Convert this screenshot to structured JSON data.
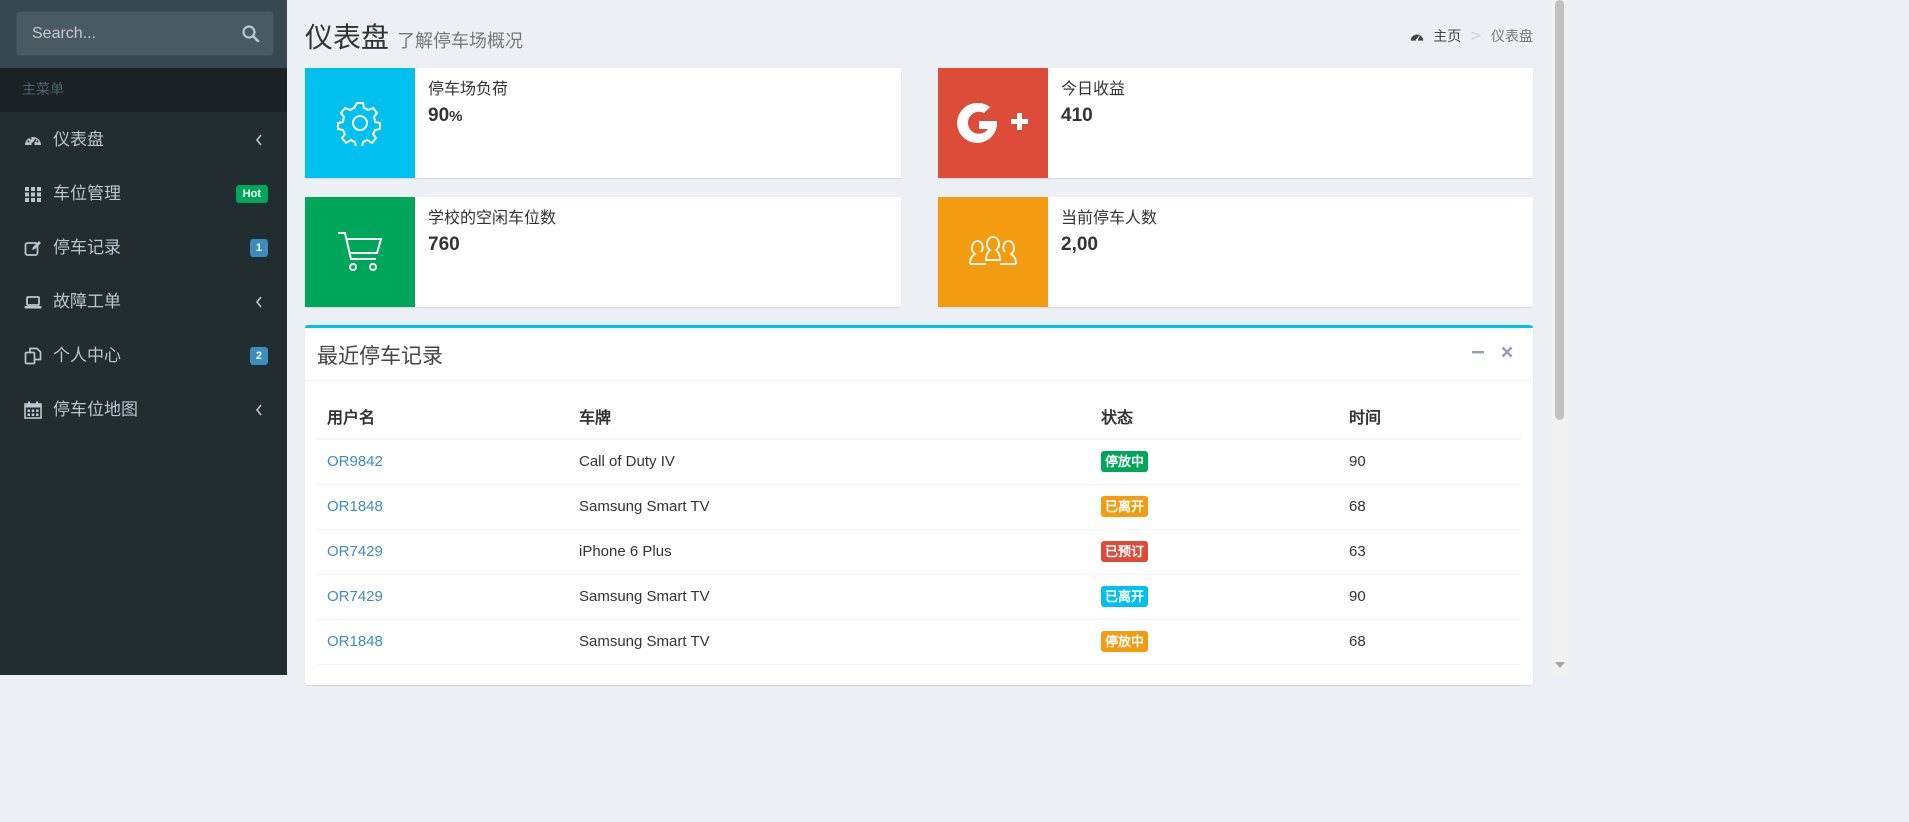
{
  "sidebar": {
    "search_placeholder": "Search...",
    "menu_header": "主菜单",
    "items": [
      {
        "label": "仪表盘",
        "icon": "dashboard-icon"
      },
      {
        "label": "车位管理",
        "icon": "grid-icon",
        "badge": "Hot"
      },
      {
        "label": "停车记录",
        "icon": "edit-icon",
        "badge": "1"
      },
      {
        "label": "故障工单",
        "icon": "laptop-icon"
      },
      {
        "label": "个人中心",
        "icon": "copy-icon",
        "badge": "2"
      },
      {
        "label": "停车位地图",
        "icon": "calendar-icon"
      }
    ]
  },
  "header": {
    "title": "仪表盘",
    "subtitle": "了解停车场概况",
    "breadcrumb": {
      "home": "主页",
      "current": "仪表盘"
    }
  },
  "info_boxes": [
    {
      "label": "停车场负荷",
      "value": "90",
      "unit": "%",
      "color": "#00c0ef",
      "icon": "gear-icon"
    },
    {
      "label": "今日收益",
      "value": "410",
      "color": "#dd4b39",
      "icon": "google-plus-icon"
    },
    {
      "label": "学校的空闲车位数",
      "value": "760",
      "color": "#00a65a",
      "icon": "cart-icon"
    },
    {
      "label": "当前停车人数",
      "value": "2,00",
      "color": "#f39c12",
      "icon": "users-icon"
    }
  ],
  "records": {
    "title": "最近停车记录",
    "accent": "#00c0ef",
    "columns": [
      "用户名",
      "车牌",
      "状态",
      "时间"
    ],
    "rows": [
      {
        "user": "OR9842",
        "plate": "Call of Duty IV",
        "status": "停放中",
        "status_color": "#00a65a",
        "time": "90"
      },
      {
        "user": "OR1848",
        "plate": "Samsung Smart TV",
        "status": "已离开",
        "status_color": "#f39c12",
        "time": "68"
      },
      {
        "user": "OR7429",
        "plate": "iPhone 6 Plus",
        "status": "已预订",
        "status_color": "#dd4b39",
        "time": "63"
      },
      {
        "user": "OR7429",
        "plate": "Samsung Smart TV",
        "status": "已离开",
        "status_color": "#00c0ef",
        "time": "90"
      },
      {
        "user": "OR1848",
        "plate": "Samsung Smart TV",
        "status": "停放中",
        "status_color": "#f39c12",
        "time": "68"
      }
    ]
  }
}
